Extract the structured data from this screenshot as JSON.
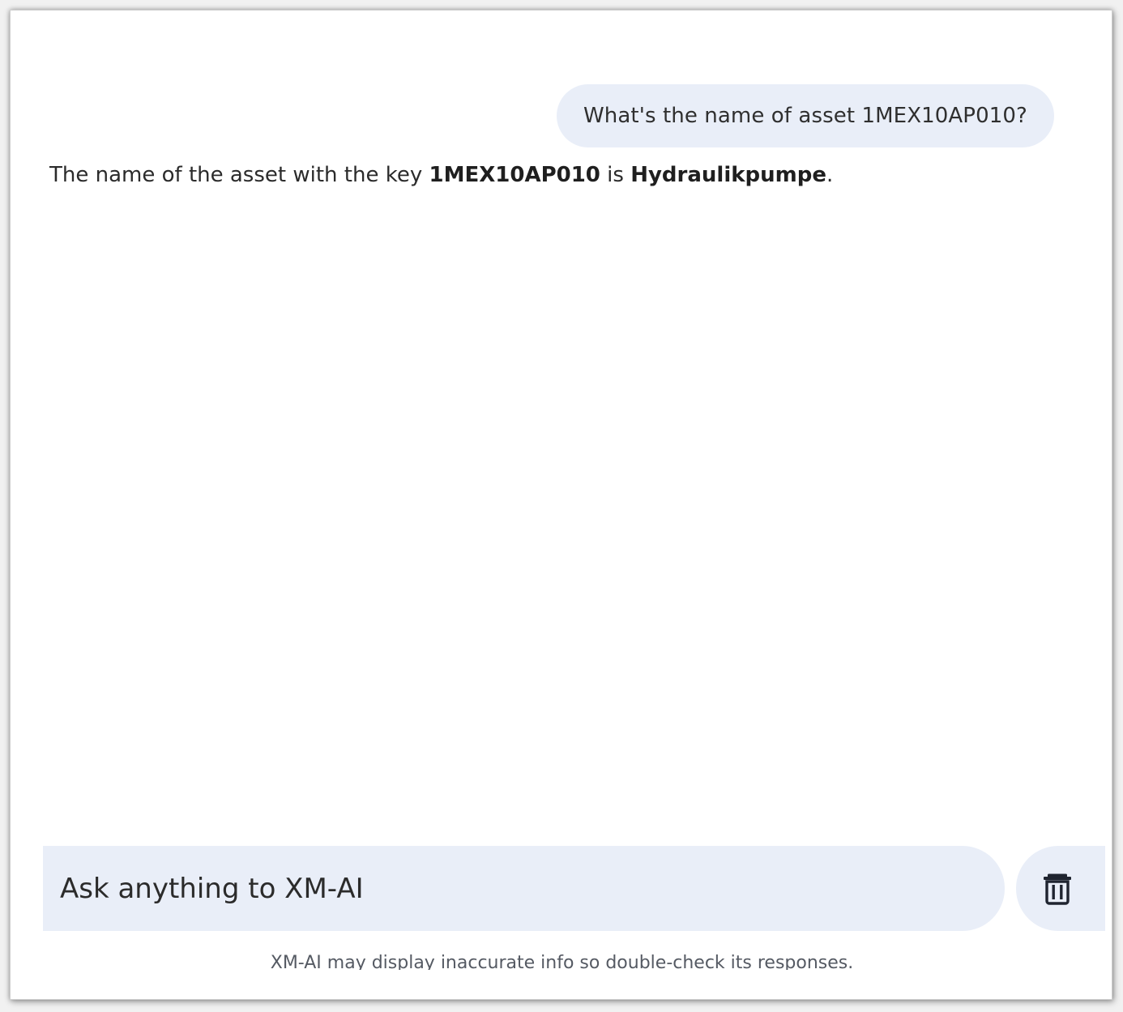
{
  "chat": {
    "user_message": "What's the name of asset 1MEX10AP010?",
    "assistant_message": {
      "prefix": "The name of the asset with the key ",
      "asset_key": "1MEX10AP010",
      "middle": " is ",
      "asset_name": "Hydraulikpumpe",
      "suffix": "."
    }
  },
  "composer": {
    "placeholder": "Ask anything to XM-AI",
    "clear_icon": "trash-icon"
  },
  "footer": {
    "disclaimer": "XM-AI may display inaccurate info so double-check its responses."
  },
  "colors": {
    "bubble_background": "#e9eef8",
    "text": "#2b2b2b",
    "page_background": "#ffffff"
  }
}
